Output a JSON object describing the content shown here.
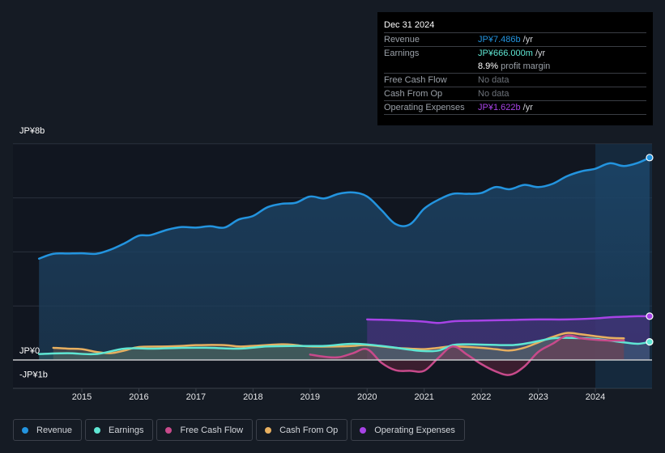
{
  "tooltip": {
    "date": "Dec 31 2024",
    "rows": [
      {
        "label": "Revenue",
        "value": "JP¥7.486b",
        "unit": " /yr",
        "color": "#2394df"
      },
      {
        "label": "Earnings",
        "value": "JP¥666.000m",
        "unit": " /yr",
        "color": "#5fe6d3"
      },
      {
        "label": "",
        "margin_value": "8.9%",
        "margin_text": " profit margin"
      },
      {
        "label": "Free Cash Flow",
        "nodata": "No data"
      },
      {
        "label": "Cash From Op",
        "nodata": "No data"
      },
      {
        "label": "Operating Expenses",
        "value": "JP¥1.622b",
        "unit": " /yr",
        "color": "#a743e6"
      }
    ]
  },
  "legend": [
    {
      "label": "Revenue",
      "color": "#2394df"
    },
    {
      "label": "Earnings",
      "color": "#5fe6d3"
    },
    {
      "label": "Free Cash Flow",
      "color": "#c84a8b"
    },
    {
      "label": "Cash From Op",
      "color": "#e8b060"
    },
    {
      "label": "Operating Expenses",
      "color": "#a743e6"
    }
  ],
  "chart_data": {
    "type": "area",
    "title": "",
    "xlabel": "",
    "ylabel": "",
    "currency_unit": "JP¥ billions",
    "x_ticks": [
      "2015",
      "2016",
      "2017",
      "2018",
      "2019",
      "2020",
      "2021",
      "2022",
      "2023",
      "2024"
    ],
    "y_ticks": [
      {
        "value": 8,
        "label": "JP¥8b"
      },
      {
        "value": 0,
        "label": "JP¥0"
      },
      {
        "value": -1,
        "label": "-JP¥1b"
      }
    ],
    "ylim": [
      -1,
      8
    ],
    "xlim": [
      2013.8,
      2025.0
    ],
    "grid": true,
    "highlight_from": 2024.0,
    "legend_position": "bottom-left",
    "series": [
      {
        "name": "Revenue",
        "color": "#2394df",
        "x": [
          2014.25,
          2014.5,
          2014.75,
          2015.0,
          2015.25,
          2015.5,
          2015.75,
          2016.0,
          2016.2,
          2016.5,
          2016.75,
          2017.0,
          2017.25,
          2017.5,
          2017.75,
          2018.0,
          2018.25,
          2018.5,
          2018.75,
          2019.0,
          2019.25,
          2019.5,
          2019.75,
          2020.0,
          2020.25,
          2020.5,
          2020.75,
          2021.0,
          2021.25,
          2021.5,
          2021.75,
          2022.0,
          2022.25,
          2022.5,
          2022.75,
          2023.0,
          2023.25,
          2023.5,
          2023.75,
          2024.0,
          2024.25,
          2024.5,
          2024.75,
          2024.95
        ],
        "values": [
          3.75,
          3.93,
          3.94,
          3.95,
          3.93,
          4.08,
          4.32,
          4.6,
          4.62,
          4.82,
          4.92,
          4.9,
          4.95,
          4.9,
          5.2,
          5.33,
          5.65,
          5.78,
          5.82,
          6.05,
          5.98,
          6.15,
          6.2,
          6.05,
          5.55,
          5.03,
          5.02,
          5.6,
          5.93,
          6.15,
          6.15,
          6.18,
          6.4,
          6.32,
          6.48,
          6.4,
          6.52,
          6.8,
          6.98,
          7.08,
          7.28,
          7.18,
          7.3,
          7.49
        ]
      },
      {
        "name": "Earnings",
        "color": "#5fe6d3",
        "x": [
          2014.25,
          2014.75,
          2015.25,
          2015.75,
          2016.25,
          2016.75,
          2017.25,
          2017.75,
          2018.25,
          2018.75,
          2019.25,
          2019.75,
          2020.25,
          2020.75,
          2021.0,
          2021.25,
          2021.5,
          2021.75,
          2022.0,
          2022.5,
          2022.75,
          2023.0,
          2023.25,
          2023.5,
          2024.0,
          2024.5,
          2024.75,
          2024.95
        ],
        "values": [
          0.22,
          0.25,
          0.22,
          0.42,
          0.42,
          0.45,
          0.45,
          0.42,
          0.5,
          0.52,
          0.52,
          0.6,
          0.52,
          0.38,
          0.33,
          0.35,
          0.55,
          0.58,
          0.57,
          0.55,
          0.6,
          0.7,
          0.8,
          0.82,
          0.78,
          0.65,
          0.6,
          0.67
        ]
      },
      {
        "name": "Free Cash Flow",
        "color": "#c84a8b",
        "x": [
          2019.0,
          2019.25,
          2019.5,
          2019.75,
          2020.0,
          2020.25,
          2020.5,
          2020.75,
          2021.0,
          2021.25,
          2021.5,
          2021.75,
          2022.0,
          2022.25,
          2022.5,
          2022.75,
          2023.0,
          2023.25,
          2023.5,
          2023.75,
          2024.0,
          2024.25,
          2024.5
        ],
        "values": [
          0.2,
          0.12,
          0.1,
          0.25,
          0.4,
          -0.1,
          -0.38,
          -0.4,
          -0.4,
          0.08,
          0.5,
          0.2,
          -0.15,
          -0.42,
          -0.55,
          -0.25,
          0.3,
          0.6,
          0.9,
          0.8,
          0.75,
          0.72,
          0.72
        ]
      },
      {
        "name": "Cash From Op",
        "color": "#e8b060",
        "x": [
          2014.5,
          2014.75,
          2015.0,
          2015.25,
          2015.5,
          2015.75,
          2016.0,
          2016.5,
          2016.75,
          2017.0,
          2017.5,
          2017.75,
          2018.0,
          2018.5,
          2018.75,
          2019.0,
          2019.5,
          2019.75,
          2020.0,
          2020.5,
          2020.75,
          2021.0,
          2021.25,
          2021.5,
          2022.0,
          2022.25,
          2022.5,
          2022.75,
          2023.0,
          2023.25,
          2023.5,
          2023.75,
          2024.0,
          2024.25,
          2024.5
        ],
        "values": [
          0.45,
          0.42,
          0.4,
          0.3,
          0.25,
          0.35,
          0.48,
          0.5,
          0.52,
          0.55,
          0.55,
          0.5,
          0.52,
          0.58,
          0.55,
          0.5,
          0.5,
          0.52,
          0.55,
          0.45,
          0.42,
          0.4,
          0.45,
          0.5,
          0.45,
          0.4,
          0.35,
          0.45,
          0.65,
          0.85,
          1.0,
          0.95,
          0.88,
          0.82,
          0.8
        ]
      },
      {
        "name": "Operating Expenses",
        "color": "#a743e6",
        "x": [
          2020.0,
          2020.25,
          2020.5,
          2020.75,
          2021.0,
          2021.25,
          2021.5,
          2021.75,
          2022.0,
          2022.5,
          2023.0,
          2023.5,
          2024.0,
          2024.25,
          2024.5,
          2024.75,
          2024.95
        ],
        "values": [
          1.5,
          1.49,
          1.47,
          1.45,
          1.42,
          1.37,
          1.43,
          1.45,
          1.46,
          1.48,
          1.5,
          1.5,
          1.54,
          1.58,
          1.6,
          1.62,
          1.62
        ]
      }
    ]
  }
}
